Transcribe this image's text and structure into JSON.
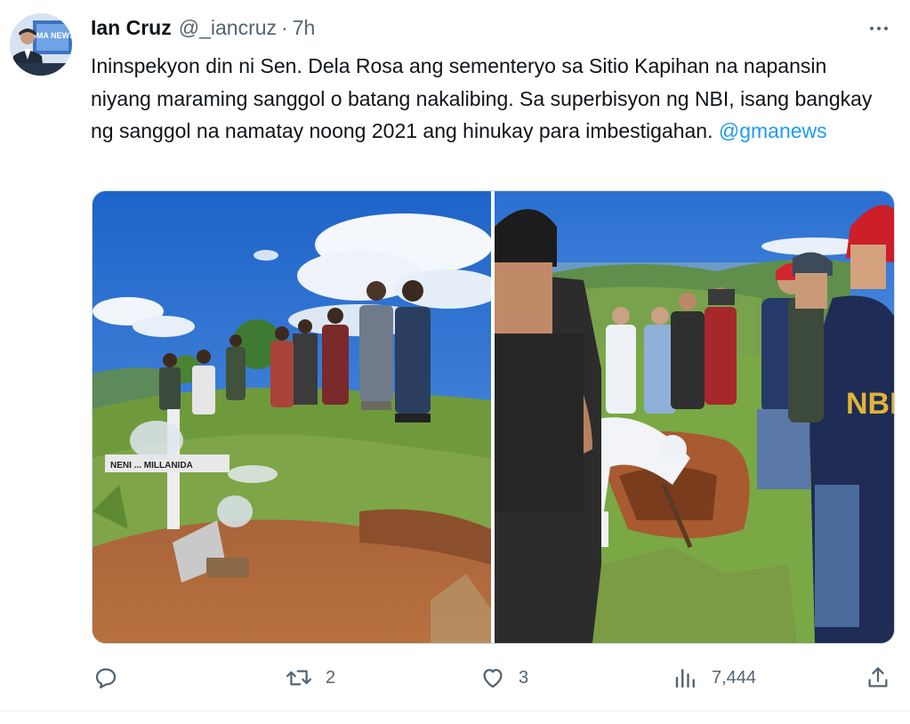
{
  "tweet": {
    "author": {
      "display_name": "Ian Cruz",
      "handle": "@_iancruz",
      "separator": "·",
      "time": "7h",
      "avatar_badge_text": "GMA NEWS"
    },
    "text": "Ininspekyon din ni Sen. Dela Rosa ang sementeryo sa Sitio Kapihan na napansin niyang maraming sanggol o batang nakalibing. Sa superbisyon ng NBI, isang bangkay ng sanggol na namatay noong 2021 ang hinukay para imbestigahan.",
    "mention": "@gmanews",
    "media": {
      "photo_1": {
        "grave_cross_text": "NENI ... MILLANIDA"
      },
      "photo_2": {
        "vest_text": "NBI"
      }
    },
    "actions": {
      "reply_count": "",
      "retweet_count": "2",
      "like_count": "3",
      "view_count": "7,444"
    }
  },
  "colors": {
    "text_primary": "#0f1419",
    "text_secondary": "#536471",
    "link": "#1d9bf0",
    "border": "#cfd9de"
  },
  "icons": [
    "more-icon",
    "reply-icon",
    "retweet-icon",
    "like-icon",
    "views-icon",
    "share-icon"
  ]
}
